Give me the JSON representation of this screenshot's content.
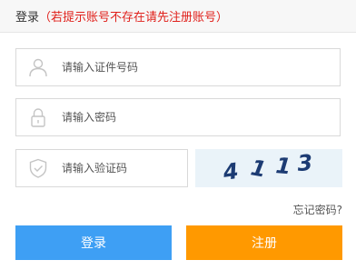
{
  "header": {
    "title": "登录",
    "hint": "（若提示账号不存在请先注册账号）"
  },
  "form": {
    "id_placeholder": "请输入证件号码",
    "password_placeholder": "请输入密码",
    "captcha_placeholder": "请输入验证码",
    "captcha_text": "4113",
    "forgot_label": "忘记密码?",
    "login_label": "登录",
    "register_label": "注册"
  },
  "colors": {
    "hint": "#e0201b",
    "login": "#3e9ff4",
    "register": "#ff9900",
    "captcha_text": "#1c3b73"
  },
  "icons": {
    "id": "user-icon",
    "password": "lock-icon",
    "captcha": "shield-icon"
  }
}
